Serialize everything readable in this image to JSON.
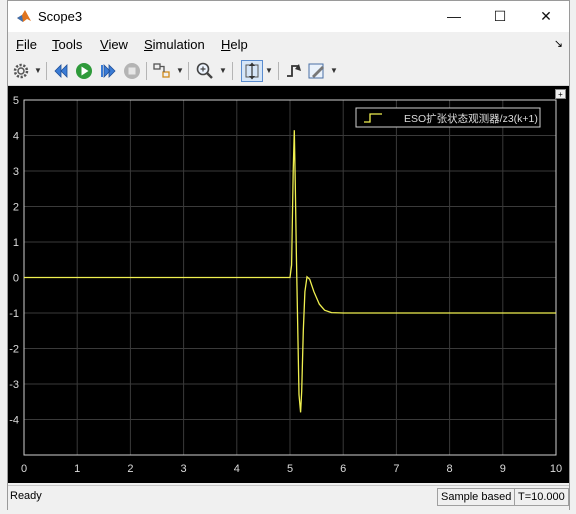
{
  "window": {
    "title": "Scope3",
    "controls": {
      "minimize": "—",
      "maximize": "☐",
      "close": "✕"
    }
  },
  "menu": [
    {
      "pre": "",
      "u": "F",
      "post": "ile"
    },
    {
      "pre": "",
      "u": "T",
      "post": "ools"
    },
    {
      "pre": "",
      "u": "V",
      "post": "iew"
    },
    {
      "pre": "",
      "u": "S",
      "post": "imulation"
    },
    {
      "pre": "",
      "u": "H",
      "post": "elp"
    }
  ],
  "dock_arrow": "↘",
  "toolbar": [
    {
      "name": "settings-icon"
    },
    {
      "name": "step-back-icon"
    },
    {
      "name": "run-icon"
    },
    {
      "name": "step-forward-icon"
    },
    {
      "name": "stop-icon"
    },
    {
      "name": "highlight-simulink-block-icon"
    },
    {
      "name": "zoom-icon"
    },
    {
      "name": "autoscale-icon"
    },
    {
      "name": "trigger-icon"
    },
    {
      "name": "style-icon"
    }
  ],
  "colors": {
    "plot_background": "#000000",
    "grid": "#3a3a3a",
    "signal": "#f0f050",
    "axis_text": "#dcdcdc"
  },
  "chart_data": {
    "type": "line",
    "title": "",
    "xlabel": "",
    "ylabel": "",
    "xlim": [
      0,
      10
    ],
    "ylim": [
      -5,
      5
    ],
    "xticks": [
      "0",
      "1",
      "2",
      "3",
      "4",
      "5",
      "6",
      "7",
      "8",
      "9",
      "10"
    ],
    "yticks": [
      "5",
      "4",
      "3",
      "2",
      "1",
      "0",
      "-1",
      "-2",
      "-3",
      "-4"
    ],
    "grid": true,
    "legend_position": "top-right",
    "series": [
      {
        "name": "ESO扩张状态观测器/z3(k+1)",
        "color": "#f0f050",
        "points": [
          [
            0,
            0
          ],
          [
            5.0,
            0
          ],
          [
            5.03,
            0.35
          ],
          [
            5.06,
            3.0
          ],
          [
            5.08,
            4.15
          ],
          [
            5.1,
            2.6
          ],
          [
            5.12,
            0.6
          ],
          [
            5.15,
            -1.8
          ],
          [
            5.17,
            -3.3
          ],
          [
            5.2,
            -3.8
          ],
          [
            5.22,
            -3.2
          ],
          [
            5.25,
            -1.5
          ],
          [
            5.28,
            -0.4
          ],
          [
            5.32,
            0.02
          ],
          [
            5.37,
            -0.05
          ],
          [
            5.45,
            -0.4
          ],
          [
            5.55,
            -0.75
          ],
          [
            5.65,
            -0.92
          ],
          [
            5.78,
            -0.99
          ],
          [
            6.0,
            -1.0
          ],
          [
            10,
            -1.0
          ]
        ]
      }
    ]
  },
  "status": {
    "ready": "Ready",
    "mode": "Sample based",
    "time": "T=10.000"
  }
}
